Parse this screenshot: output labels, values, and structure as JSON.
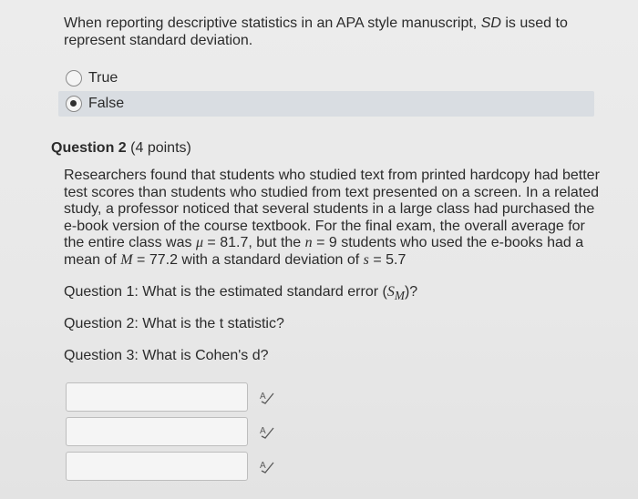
{
  "question1": {
    "prompt_before": "When reporting descriptive statistics in an APA style manuscript, ",
    "prompt_em": "SD",
    "prompt_after": " is used to represent standard deviation.",
    "options": [
      {
        "label": "True",
        "selected": false
      },
      {
        "label": "False",
        "selected": true
      }
    ]
  },
  "question2": {
    "title": "Question 2",
    "points": "(4 points)",
    "body_parts": {
      "p1": "Researchers found that students who studied text from printed hardcopy had better test scores than students who studied from text presented on a screen. In a related study, a professor noticed that several students in a large class had purchased the e-book version of the course textbook. For the final exam, the overall average for the entire class was ",
      "mu": "μ",
      "p2": " = 81.7, but the ",
      "n": "n",
      "p3": " = 9 students who used the e-books had a mean of ",
      "M": "M",
      "p4": " = 77.2 with a standard deviation of ",
      "s": "s",
      "p5": " = 5.7"
    },
    "sub_questions": {
      "q1_before": "Question 1: What is the estimated standard error (",
      "q1_sym": "S",
      "q1_sub": "M",
      "q1_after": ")?",
      "q2": "Question 2: What is the t statistic?",
      "q3": "Question 3: What is Cohen's d?"
    },
    "answers": [
      "",
      "",
      ""
    ]
  },
  "icons": {
    "spell_check": "spell-check-icon"
  }
}
